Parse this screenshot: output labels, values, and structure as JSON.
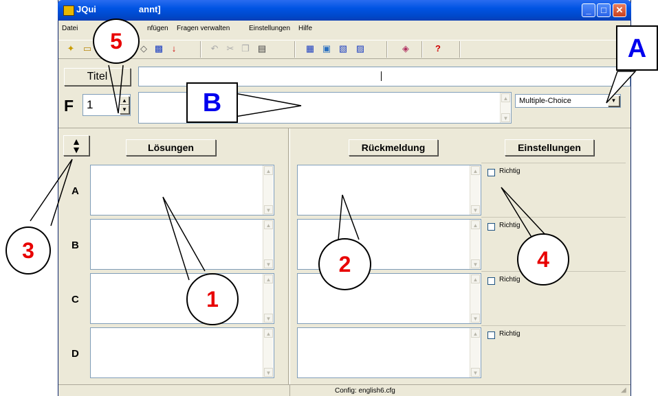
{
  "window": {
    "title": "JQuiz [unbenannt]",
    "title_visible_left": "JQui",
    "title_visible_right": "annt]",
    "min_glyph": "_",
    "max_glyph": "□",
    "close_glyph": "✕"
  },
  "menu": {
    "items": [
      "Datei",
      "nfügen",
      "Fragen verwalten",
      "Einstellungen",
      "Hilfe"
    ]
  },
  "toolbar": {
    "icons": [
      "new-file-icon",
      "open-folder-icon",
      "tag-icon",
      "web-export-icon",
      "down-arrow-icon",
      "undo-icon",
      "cut-icon",
      "copy-icon",
      "paste-icon",
      "export-html-icon",
      "export-hotpot-icon",
      "export-web-icon",
      "export-drop-icon",
      "config-icon",
      "help-icon"
    ],
    "help_glyph": "?"
  },
  "header": {
    "title_button": "Titel",
    "question_prefix": "F",
    "question_number": "1",
    "title_input_value": "",
    "question_input_value": "",
    "question_type": "Multiple-Choice"
  },
  "columns": {
    "answers_button": "Lösungen",
    "feedback_button": "Rückmeldung",
    "settings_button": "Einstellungen"
  },
  "rows": [
    {
      "label": "A",
      "answer": "",
      "feedback": "",
      "correct_label": "Richtig",
      "correct": false
    },
    {
      "label": "B",
      "answer": "",
      "feedback": "",
      "correct_label": "Richtig",
      "correct": false
    },
    {
      "label": "C",
      "answer": "",
      "feedback": "",
      "correct_label": "Richtig",
      "correct": false
    },
    {
      "label": "D",
      "answer": "",
      "feedback": "",
      "correct_label": "Richtig",
      "correct": false
    }
  ],
  "status": {
    "config": "Config: english6.cfg"
  },
  "annotations": {
    "callout_1": "1",
    "callout_2": "2",
    "callout_3": "3",
    "callout_4": "4",
    "callout_5": "5",
    "box_A": "A",
    "box_B": "B"
  },
  "colors": {
    "callout_number": "#e80000",
    "callout_letter": "#0000ee",
    "titlebar": "#0054e3"
  }
}
